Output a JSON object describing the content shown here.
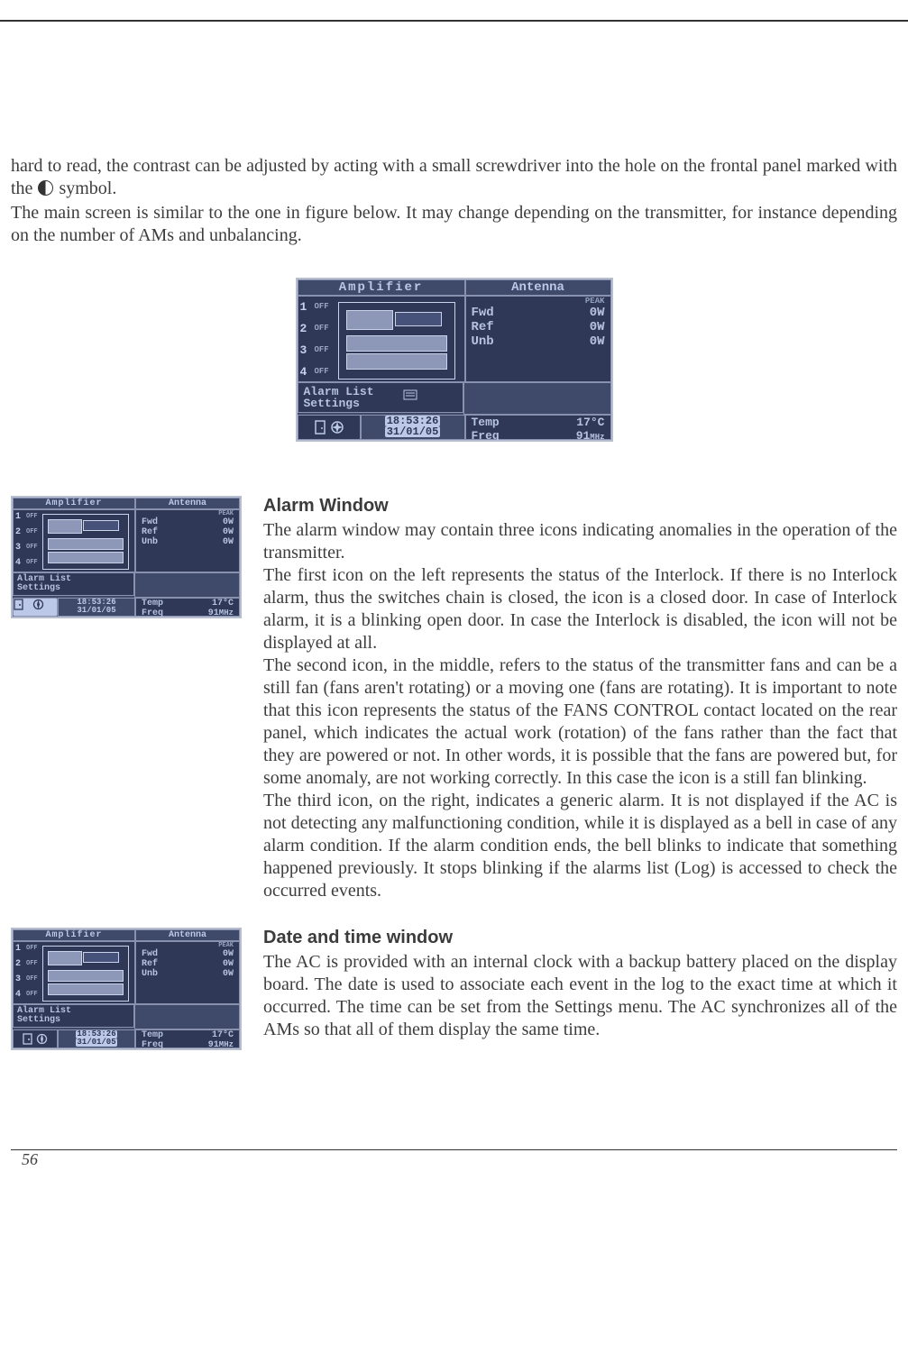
{
  "page_number": "56",
  "intro": {
    "line1a": "hard to read, the contrast can be adjusted by acting with a small screwdriver into the hole on the frontal panel marked with the ",
    "line1b": " symbol.",
    "line2": "The main screen is similar to the one in figure below. It may change depending on the transmitter, for instance depending on the number of AMs and unbalancing."
  },
  "lcd": {
    "amp_title": "Amplifier",
    "ant_title": "Antenna",
    "peak": "PEAK",
    "off": "OFF",
    "channels": [
      "1",
      "2",
      "3",
      "4"
    ],
    "ant_rows": [
      {
        "label": "Fwd",
        "value": "0W"
      },
      {
        "label": "Ref",
        "value": "0W"
      },
      {
        "label": "Unb",
        "value": "0W"
      }
    ],
    "alarm_list": "Alarm List",
    "settings": "Settings",
    "time": "18:53:26",
    "date": "31/01/05",
    "temp_label": "Temp",
    "temp_value": "17°C",
    "freq_label": "Freq",
    "freq_value": "91",
    "freq_unit": "MHz"
  },
  "sections": {
    "alarm": {
      "title": "Alarm Window",
      "body": "The alarm window may contain three icons indicating anomalies in the operation of the transmitter.\nThe first icon on the left represents the status of the Interlock. If there is no Interlock alarm, thus the switches chain is closed, the icon is a closed door. In case of Interlock alarm, it is a blinking open door. In case the Interlock is disabled, the icon will not be displayed at all.\nThe second icon, in the middle, refers to the status of the transmitter fans and can be a still fan (fans aren't rotating) or a moving one (fans are rotating). It is important to note that this icon represents the status of the FANS CONTROL contact located on the rear panel, which indicates the actual work (rotation) of the fans rather than the fact that they are powered or not. In other words, it is possible that the fans are powered but, for some anomaly, are not working correctly. In this case the icon is a still fan blinking.\nThe third icon, on the right, indicates a generic alarm. It is not displayed if the AC is not detecting any malfunctioning condition, while it is displayed as a bell in case of any alarm condition. If the alarm condition ends, the bell blinks to indicate that something happened previously. It stops blinking if the alarms list (Log) is accessed to check the occurred events."
    },
    "datetime": {
      "title": "Date and time window",
      "body": "The AC is provided with an internal clock with a backup battery placed on the display board. The date is used to associate each event in the log to the exact time at which it occurred. The time can be set from the Settings menu. The AC synchronizes all of the AMs so that all of them display the same time."
    }
  }
}
